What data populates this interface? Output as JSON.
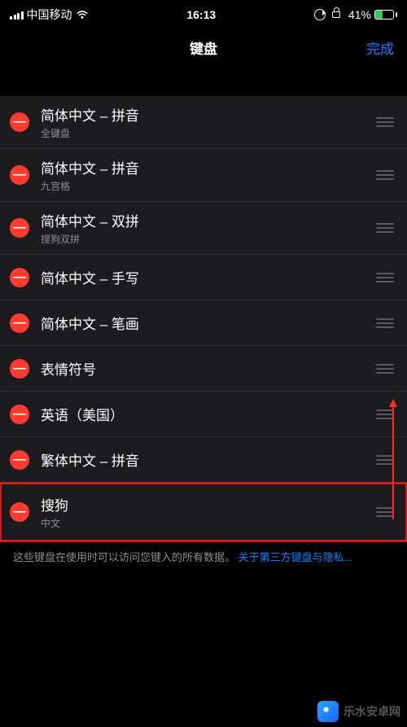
{
  "status": {
    "carrier": "中国移动",
    "time": "16:13",
    "battery_pct": "41%"
  },
  "nav": {
    "title": "键盘",
    "done": "完成"
  },
  "keyboards": [
    {
      "title": "简体中文 – 拼音",
      "subtitle": "全键盘"
    },
    {
      "title": "简体中文 – 拼音",
      "subtitle": "九宫格"
    },
    {
      "title": "简体中文 – 双拼",
      "subtitle": "搜狗双拼"
    },
    {
      "title": "简体中文 – 手写",
      "subtitle": ""
    },
    {
      "title": "简体中文 – 笔画",
      "subtitle": ""
    },
    {
      "title": "表情符号",
      "subtitle": ""
    },
    {
      "title": "英语（美国）",
      "subtitle": ""
    },
    {
      "title": "繁体中文 – 拼音",
      "subtitle": ""
    },
    {
      "title": "搜狗",
      "subtitle": "中文",
      "highlight": true
    }
  ],
  "footer": {
    "text": "这些键盘在使用时可以访问您键入的所有数据。",
    "link": "关于第三方键盘与隐私..."
  },
  "watermark": "乐水安卓网"
}
